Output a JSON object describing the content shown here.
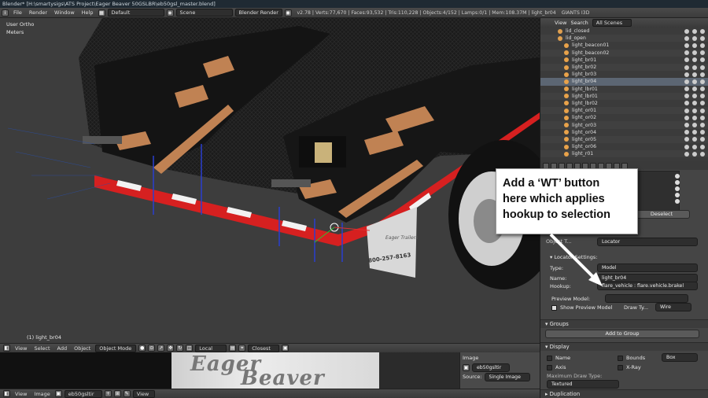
{
  "window": {
    "title": "Blender* [H:\\smartysigs\\ATS Project\\Eager Beaver 50GSLBR\\eb50gsl_master.blend]"
  },
  "menubar": {
    "items": [
      "File",
      "Render",
      "Window",
      "Help"
    ],
    "screen_layout": "Default",
    "scene": "Scene",
    "engine": "Blender Render",
    "stats": "v2.78 | Verts:77,670 | Faces:93,532 | Tris:110,228 | Objects:4/152 | Lamps:0/1 | Mem:108.37M | light_br04",
    "giants": "GIANTS I3D"
  },
  "viewport": {
    "view_label": "User Ortho",
    "units_label": "Meters",
    "object_label": "(1) light_br04",
    "trailer_text": "800-257-8163",
    "logo_text": "Eager Trailers"
  },
  "viewport_header": {
    "items": [
      "View",
      "Select",
      "Add",
      "Object"
    ],
    "mode": "Object Mode",
    "pivot": "Local",
    "snap": "Closest"
  },
  "image_editor": {
    "image_name": "eb50gsltir",
    "source_label": "Source:",
    "source_value": "Single Image",
    "panel_title": "Image",
    "texture_text_1": "Eager",
    "texture_text_2": "Beaver",
    "header_items": [
      "View",
      "Image"
    ],
    "header_image": "eb50gsltir",
    "header_view": "View"
  },
  "outliner": {
    "view": "View",
    "search": "Search",
    "filter": "All Scenes",
    "rows": [
      {
        "name": "lid_closed"
      },
      {
        "name": "lid_open"
      },
      {
        "name": "light_beacon01"
      },
      {
        "name": "light_beacon02"
      },
      {
        "name": "light_br01"
      },
      {
        "name": "light_br02"
      },
      {
        "name": "light_br03"
      },
      {
        "name": "light_br04"
      },
      {
        "name": "light_lbr01"
      },
      {
        "name": "light_lbr01"
      },
      {
        "name": "light_lbr02"
      },
      {
        "name": "light_or01"
      },
      {
        "name": "light_or02"
      },
      {
        "name": "light_or03"
      },
      {
        "name": "light_or04"
      },
      {
        "name": "light_or05"
      },
      {
        "name": "light_or06"
      },
      {
        "name": "light_r01"
      }
    ]
  },
  "properties": {
    "deselect_label": "Deselect",
    "object_label": "Object T...",
    "locator_value": "Locator",
    "locator_settings": "Locator Settings:",
    "type_label": "Type:",
    "type_value": "Model",
    "name_label": "Name:",
    "name_value": "light_br04",
    "hookup_label": "Hookup:",
    "hookup_value": "flare_vehicle : flare.vehicle.brakel",
    "preview_label": "Preview Model:",
    "show_preview": "Show Preview Model",
    "draw_type_label": "Draw Ty...",
    "draw_type_value": "Wire",
    "groups": "Groups",
    "add_to_group": "Add to Group",
    "display": "Display",
    "name_opt": "Name",
    "axis_opt": "Axis",
    "bounds_opt": "Bounds",
    "box_value": "Box",
    "xray_opt": "X-Ray",
    "max_draw_type": "Maximum Draw Type:",
    "textured": "Textured",
    "duplication": "Duplication"
  },
  "callout": {
    "lines": [
      "Add a ‘WT’ button",
      "here which applies",
      "hookup to selection"
    ]
  },
  "colors": {
    "callout_bg": "#ffffff",
    "selected_row": "#5c6673",
    "bulb": "#e8a24a",
    "wood": "#c98a5a",
    "hazard_red": "#d62020"
  }
}
